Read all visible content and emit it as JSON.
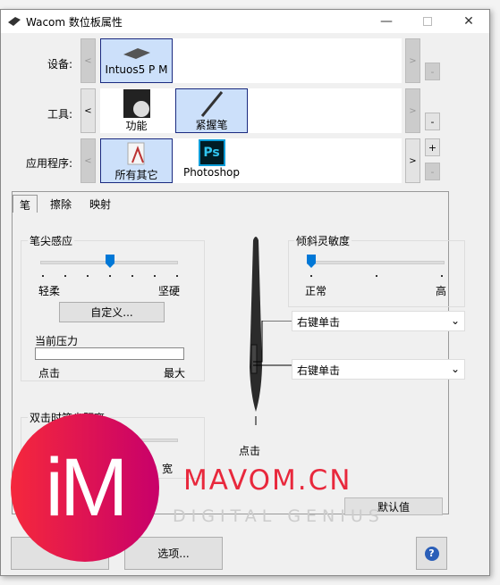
{
  "window": {
    "title": "Wacom 数位板属性",
    "icon": "tablet-icon"
  },
  "rows": {
    "device": {
      "label": "设备:",
      "items": [
        {
          "label": "Intuos5 P M",
          "selected": true
        }
      ]
    },
    "tool": {
      "label": "工具:",
      "items": [
        {
          "label": "功能",
          "selected": false
        },
        {
          "label": "紧握笔",
          "selected": true
        }
      ]
    },
    "application": {
      "label": "应用程序:",
      "items": [
        {
          "label": "所有其它",
          "selected": true
        },
        {
          "label": "Photoshop",
          "selected": false
        }
      ]
    }
  },
  "buttons": {
    "prev": "<",
    "next": ">",
    "add": "+",
    "remove": "-",
    "minimize": "—",
    "close": "✕"
  },
  "tabs": [
    {
      "label": "笔",
      "selected": true
    },
    {
      "label": "擦除"
    },
    {
      "label": "映射"
    }
  ],
  "tip_feel": {
    "title": "笔尖感应",
    "min": "轻柔",
    "max": "坚硬",
    "value_step": 3,
    "steps": 7,
    "customize": "自定义...",
    "pressure_label": "当前压力",
    "pressure_min": "点击",
    "pressure_max": "最大",
    "pressure_value": 0
  },
  "tilt": {
    "title": "倾斜灵敏度",
    "min": "正常",
    "max": "高",
    "value_step": 0
  },
  "side_buttons": {
    "upper": "右键单击",
    "lower": "右键单击"
  },
  "tip_label": "点击",
  "double_click": {
    "title": "双击时笔尖距离",
    "max": "宽"
  },
  "default_button": "默认值",
  "options_button": "选项...",
  "help_icon": "help-icon",
  "watermark": {
    "logo": "iM",
    "text": "MAVOM.CN",
    "tagline": "DIGITAL GENIUS",
    "color": "#e8283c"
  },
  "colors": {
    "selected_tile": "#cce0fa",
    "selected_border": "#1a2a80"
  }
}
